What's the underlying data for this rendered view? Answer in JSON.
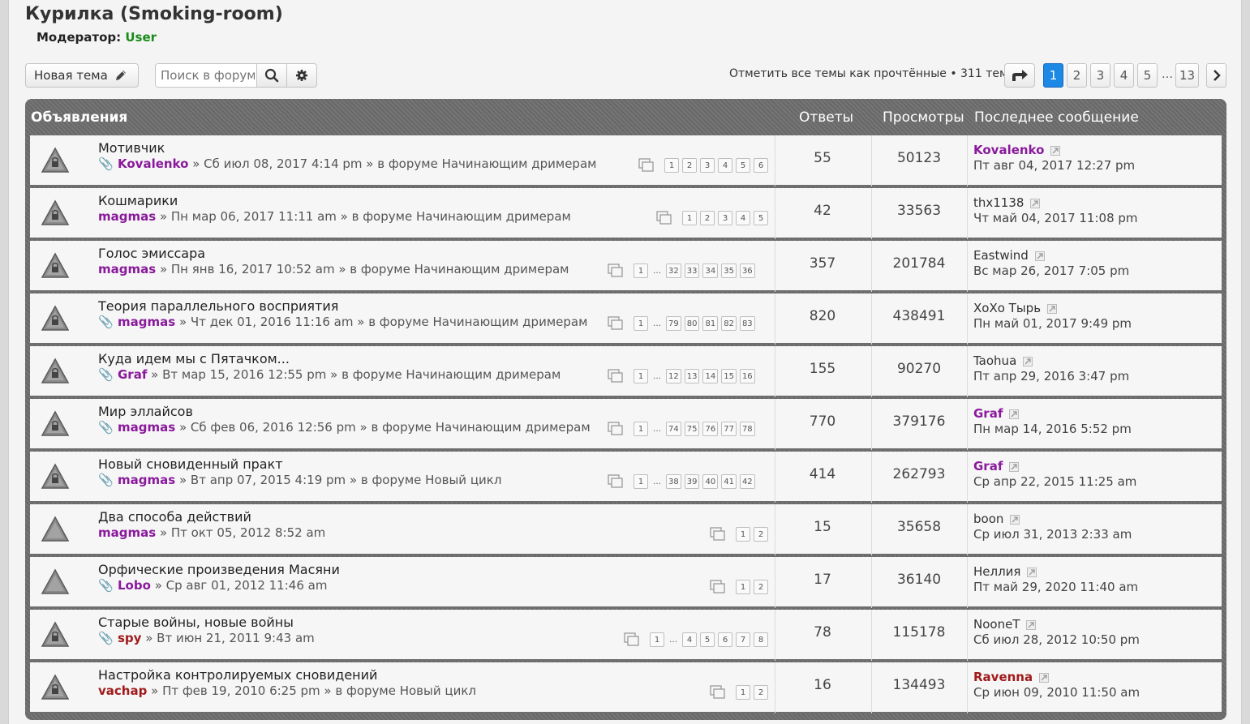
{
  "forum": {
    "title": "Курилка (Smoking-room)",
    "moderator_label": "Модератор:",
    "moderator_user": "User"
  },
  "toolbar": {
    "new_topic_label": "Новая тема",
    "search_placeholder": "Поиск в форуме…",
    "mark_read": "Отметить все темы как прочтённые • 311 тем"
  },
  "pagination": {
    "pages": [
      "1",
      "2",
      "3",
      "4",
      "5"
    ],
    "active": "1",
    "ellipsis": "…",
    "last": "13"
  },
  "table_header": {
    "announcements": "Объявления",
    "answers": "Ответы",
    "views": "Просмотры",
    "last_post": "Последнее сообщение"
  },
  "topics": [
    {
      "title": "Мотивчик",
      "attach": true,
      "author": "Kovalenko",
      "author_color": "#8a1a9c",
      "meta": "» Сб июл 08, 2017 4:14 pm » в форуме Начинающим дримерам",
      "pages": [
        "1",
        "2",
        "3",
        "4",
        "5",
        "6"
      ],
      "answers": "55",
      "views": "50123",
      "last_author": "Kovalenko",
      "last_style": "purple",
      "last_date": "Пт авг 04, 2017 12:27 pm"
    },
    {
      "title": "Кошмарики",
      "attach": false,
      "author": "magmas",
      "author_color": "#8a1a9c",
      "meta": "» Пн мар 06, 2017 11:11 am » в форуме Начинающим дримерам",
      "pages": [
        "1",
        "2",
        "3",
        "4",
        "5"
      ],
      "answers": "42",
      "views": "33563",
      "last_author": "thx1138",
      "last_style": "plain",
      "last_date": "Чт май 04, 2017 11:08 pm"
    },
    {
      "title": "Голос эмиссара",
      "attach": false,
      "author": "magmas",
      "author_color": "#8a1a9c",
      "meta": "» Пн янв 16, 2017 10:52 am » в форуме Начинающим дримерам",
      "pages": [
        "1",
        "…",
        "32",
        "33",
        "34",
        "35",
        "36"
      ],
      "answers": "357",
      "views": "201784",
      "last_author": "Eastwind",
      "last_style": "plain",
      "last_date": "Вс мар 26, 2017 7:05 pm"
    },
    {
      "title": "Теория параллельного восприятия",
      "attach": true,
      "author": "magmas",
      "author_color": "#8a1a9c",
      "meta": "» Чт дек 01, 2016 11:16 am » в форуме Начинающим дримерам",
      "pages": [
        "1",
        "…",
        "79",
        "80",
        "81",
        "82",
        "83"
      ],
      "answers": "820",
      "views": "438491",
      "last_author": "XoXo Тырь",
      "last_style": "plain",
      "last_date": "Пн май 01, 2017 9:49 pm"
    },
    {
      "title": "Куда идем мы с Пятачком...",
      "attach": true,
      "author": "Graf",
      "author_color": "#8a1a9c",
      "meta": "» Вт мар 15, 2016 12:55 pm » в форуме Начинающим дримерам",
      "pages": [
        "1",
        "…",
        "12",
        "13",
        "14",
        "15",
        "16"
      ],
      "answers": "155",
      "views": "90270",
      "last_author": "Taohua",
      "last_style": "plain",
      "last_date": "Пт апр 29, 2016 3:47 pm"
    },
    {
      "title": "Мир эллайсов",
      "attach": true,
      "author": "magmas",
      "author_color": "#8a1a9c",
      "meta": "» Сб фев 06, 2016 12:56 pm » в форуме Начинающим дримерам",
      "pages": [
        "1",
        "…",
        "74",
        "75",
        "76",
        "77",
        "78"
      ],
      "answers": "770",
      "views": "379176",
      "last_author": "Graf",
      "last_style": "purple",
      "last_date": "Пн мар 14, 2016 5:52 pm"
    },
    {
      "title": "Новый сновиденный практ",
      "attach": true,
      "author": "magmas",
      "author_color": "#8a1a9c",
      "meta": "» Вт апр 07, 2015 4:19 pm » в форуме Новый цикл",
      "pages": [
        "1",
        "…",
        "38",
        "39",
        "40",
        "41",
        "42"
      ],
      "answers": "414",
      "views": "262793",
      "last_author": "Graf",
      "last_style": "purple",
      "last_date": "Ср апр 22, 2015 11:25 am"
    },
    {
      "title": "Два способа действий",
      "attach": false,
      "author": "magmas",
      "author_color": "#8a1a9c",
      "meta": "» Пт окт 05, 2012 8:52 am",
      "pages": [
        "1",
        "2"
      ],
      "answers": "15",
      "views": "35658",
      "last_author": "boon",
      "last_style": "plain",
      "last_date": "Ср июл 31, 2013 2:33 am"
    },
    {
      "title": "Орфические произведения Масяни",
      "attach": true,
      "author": "Lobo",
      "author_color": "#8a1a9c",
      "meta": "» Ср авг 01, 2012 11:46 am",
      "pages": [
        "1",
        "2"
      ],
      "answers": "17",
      "views": "36140",
      "last_author": "Неллия",
      "last_style": "plain",
      "last_date": "Пт май 29, 2020 11:40 am"
    },
    {
      "title": "Старые войны, новые войны",
      "attach": true,
      "author": "spy",
      "author_color": "#a01a1a",
      "meta": "» Вт июн 21, 2011 9:43 am",
      "pages": [
        "1",
        "…",
        "4",
        "5",
        "6",
        "7",
        "8"
      ],
      "answers": "78",
      "views": "115178",
      "last_author": "NooneT",
      "last_style": "plain",
      "last_date": "Сб июл 28, 2012 10:50 pm"
    },
    {
      "title": "Настройка контролируемых сновидений",
      "attach": false,
      "author": "vachap",
      "author_color": "#a01a1a",
      "meta": "» Пт фев 19, 2010 6:25 pm » в форуме Новый цикл",
      "pages": [
        "1",
        "2"
      ],
      "answers": "16",
      "views": "134493",
      "last_author": "Ravenna",
      "last_style": "red",
      "last_date": "Ср июн 09, 2010 11:50 am"
    }
  ]
}
